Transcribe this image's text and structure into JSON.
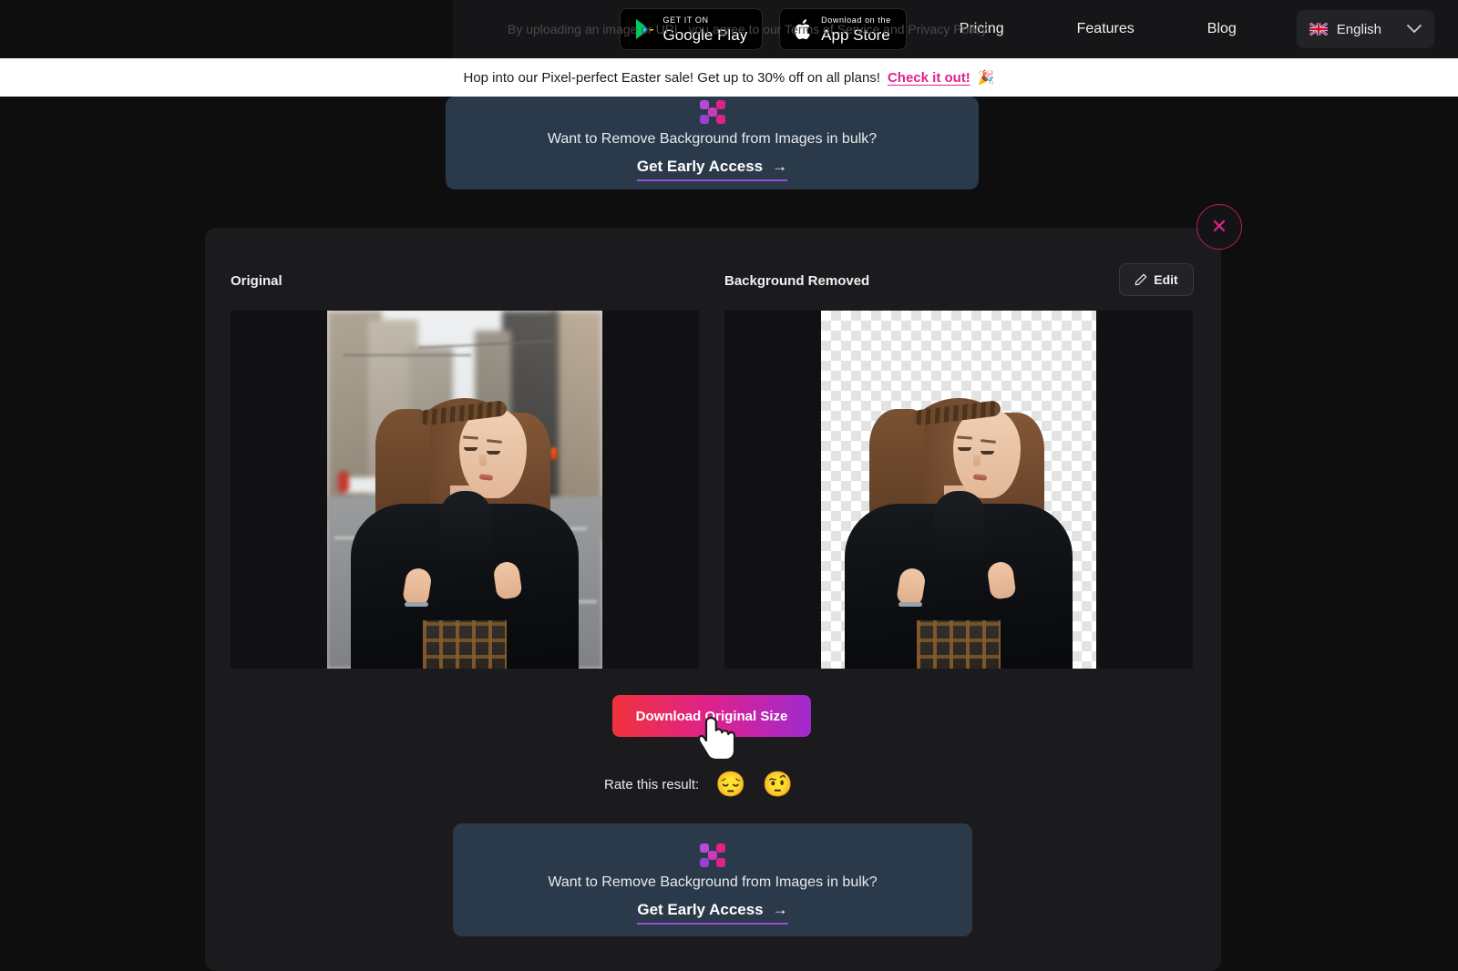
{
  "nav": {
    "legal_ghost_text": "By uploading an image or URL, you agree to our Terms of Service and Privacy Policy",
    "google_play": {
      "small": "GET IT ON",
      "big": "Google Play"
    },
    "app_store": {
      "small": "Download on the",
      "big": "App Store"
    },
    "links": [
      {
        "label": "Pricing"
      },
      {
        "label": "Features"
      },
      {
        "label": "Blog"
      }
    ],
    "language": {
      "label": "English",
      "chevron": "⌄"
    }
  },
  "promo": {
    "text": "Hop into our Pixel-perfect Easter sale! Get up to 30% off on all plans!",
    "link": "Check it out!",
    "emoji": "🎉",
    "bg": "#ffffff",
    "link_color": "#e0218a"
  },
  "bulk_cta_top": {
    "title": "Want to Remove Background from Images in bulk?",
    "cta": "Get Early Access",
    "arrow": "→",
    "bg": "#2b3a4a"
  },
  "bulk_cta_bottom": {
    "title": "Want to Remove Background from Images in bulk?",
    "cta": "Get Early Access",
    "arrow": "→",
    "bg": "#2b3a4a"
  },
  "panel": {
    "close_glyph": "✕",
    "original_label": "Original",
    "removed_label": "Background Removed",
    "edit_label": "Edit",
    "download_label": "Download Original Size",
    "download_gradient_from": "#f0333c",
    "download_gradient_to": "#a02ad0"
  },
  "rating": {
    "label": "Rate this result:",
    "options": [
      {
        "emoji": "😔",
        "name": "pensive-face"
      },
      {
        "emoji": "🤨",
        "name": "neutral-face"
      }
    ]
  },
  "colors": {
    "page_bg": "#0e0e0f",
    "panel_bg": "#1b1b1d",
    "image_pane_bg": "#111113",
    "accent_pink": "#e0218a",
    "accent_purple": "#9b4dd4"
  }
}
